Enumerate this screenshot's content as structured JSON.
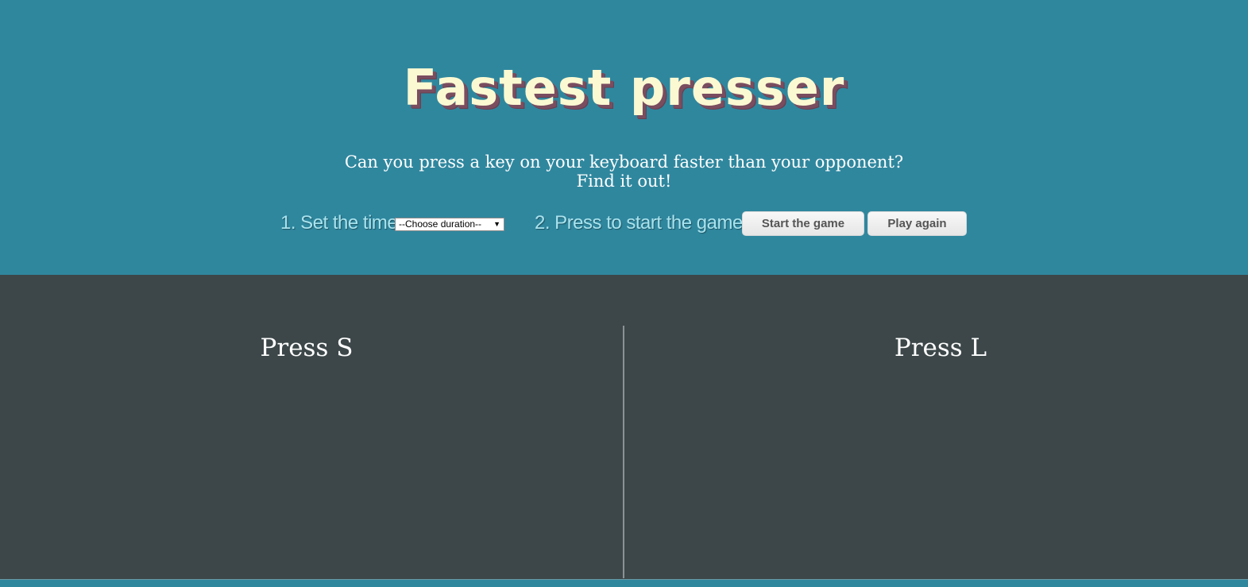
{
  "header": {
    "title": "Fastest presser",
    "subtitle_line1": "Can you press a key on your keyboard faster than your opponent?",
    "subtitle_line2": "Find it out!"
  },
  "controls": {
    "step1_label": "1. Set the time",
    "duration_select": {
      "selected": "--Choose duration--"
    },
    "step2_label": "2. Press to start the game!",
    "start_button": "Start the game",
    "play_again_button": "Play again"
  },
  "arena": {
    "left_player_prompt": "Press S",
    "right_player_prompt": "Press L"
  },
  "colors": {
    "header_bg": "#2f879e",
    "arena_bg": "#3d4749",
    "title_fill": "#fbf9d2",
    "title_shadow": "#7a4d5f",
    "step_label": "#a9e3ee"
  },
  "icons": {
    "select_arrow": "caret-down-icon"
  }
}
